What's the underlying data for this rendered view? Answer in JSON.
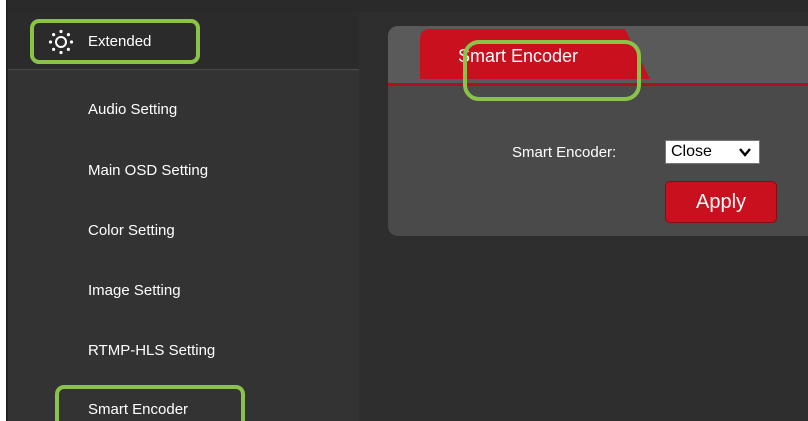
{
  "sidebar": {
    "header_label": "Extended",
    "header_icon": "gear-icon",
    "items": [
      {
        "label": "Audio Setting"
      },
      {
        "label": "Main OSD Setting"
      },
      {
        "label": "Color Setting"
      },
      {
        "label": "Image Setting"
      },
      {
        "label": "RTMP-HLS Setting"
      },
      {
        "label": "Smart Encoder"
      }
    ]
  },
  "main": {
    "tab_label": "Smart Encoder",
    "field_label": "Smart Encoder:",
    "select_value": "Close",
    "apply_label": "Apply"
  },
  "colors": {
    "accent_red": "#c8101e",
    "highlight_green": "#8bc34a",
    "background_dark": "#333333"
  }
}
